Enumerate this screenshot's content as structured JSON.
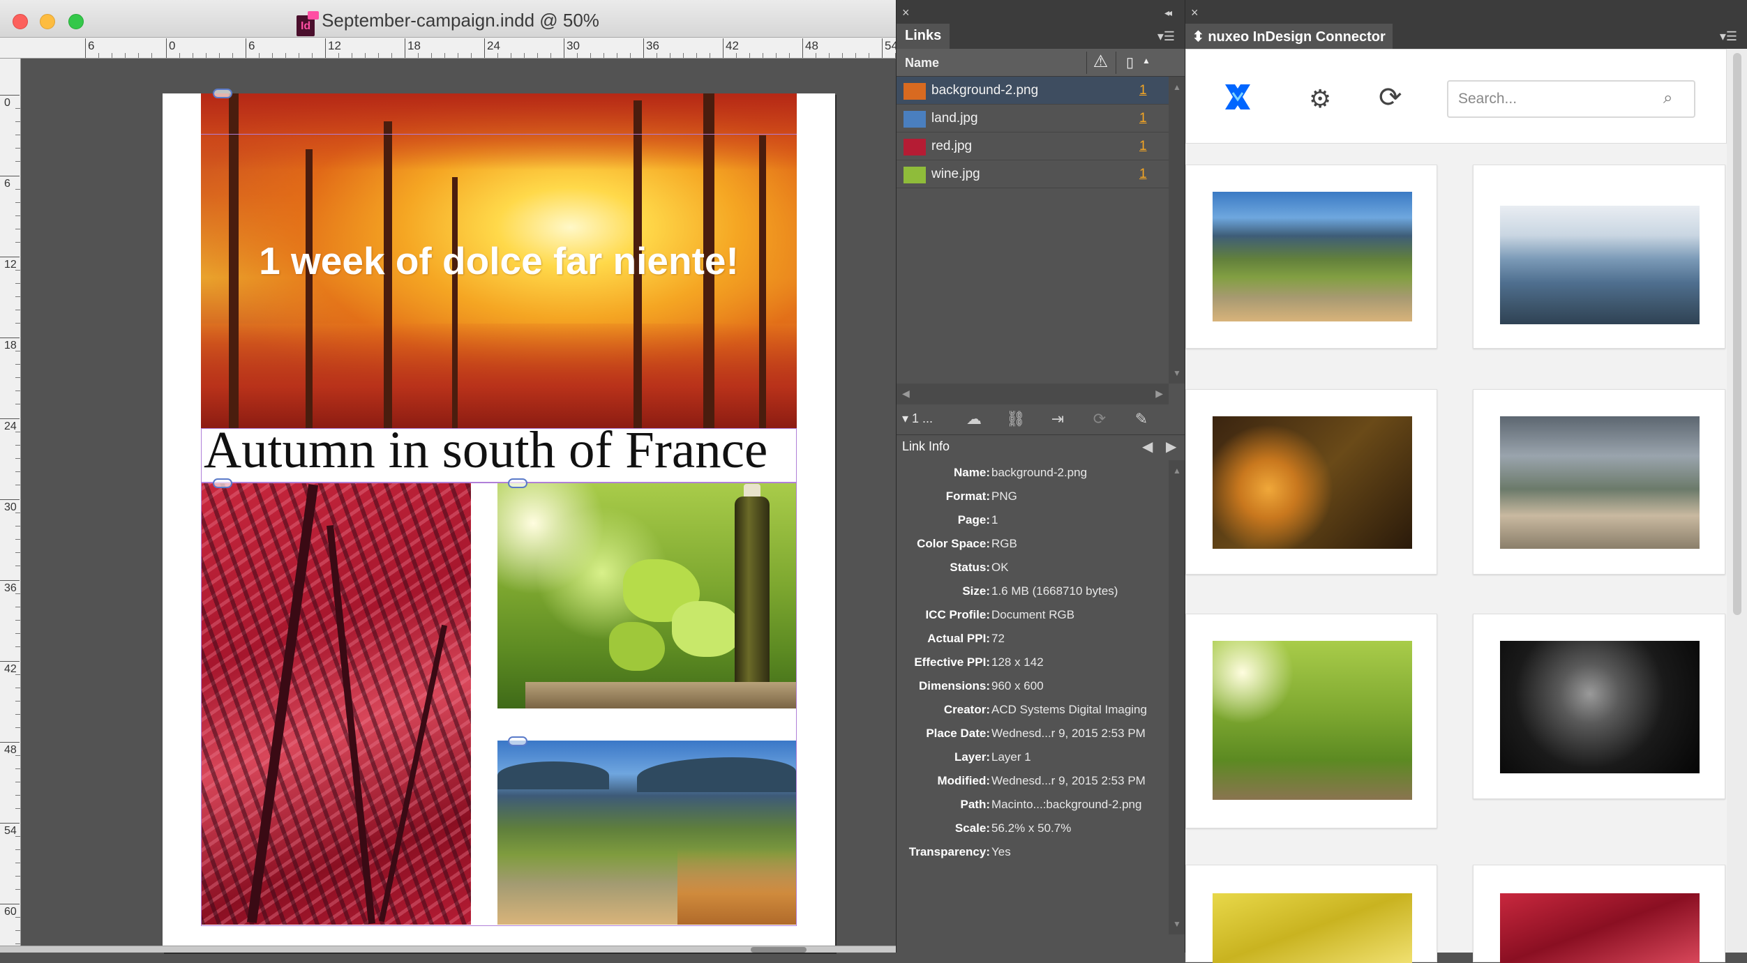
{
  "document_window": {
    "title": "September-campaign.indd @ 50%",
    "ruler_top_labels": [
      "6",
      "0",
      "6",
      "12",
      "18",
      "24",
      "30",
      "36",
      "42",
      "48",
      "54"
    ],
    "ruler_left_labels": [
      "0",
      "6",
      "12",
      "18",
      "24",
      "30",
      "36",
      "42",
      "48",
      "54",
      "60"
    ],
    "hero_text": "1 week of dolce far niente!",
    "heading": "Autumn in south of France"
  },
  "links_panel": {
    "tab_label": "Links",
    "column_name": "Name",
    "links": [
      {
        "name": "background-2.png",
        "page": "1",
        "selected": true,
        "thumb_color": "#d86a20"
      },
      {
        "name": "land.jpg",
        "page": "1",
        "selected": false,
        "thumb_color": "#4a7fbf"
      },
      {
        "name": "red.jpg",
        "page": "1",
        "selected": false,
        "thumb_color": "#b51c34"
      },
      {
        "name": "wine.jpg",
        "page": "1",
        "selected": false,
        "thumb_color": "#8fbc3a"
      }
    ],
    "selection_count": "1 ...",
    "link_info_title": "Link Info",
    "link_info": [
      {
        "key": "Name:",
        "value": "background-2.png"
      },
      {
        "key": "Format:",
        "value": "PNG"
      },
      {
        "key": "Page:",
        "value": "1"
      },
      {
        "key": "Color Space:",
        "value": "RGB"
      },
      {
        "key": "Status:",
        "value": "OK"
      },
      {
        "key": "Size:",
        "value": "1.6 MB (1668710 bytes)"
      },
      {
        "key": "ICC Profile:",
        "value": "Document RGB"
      },
      {
        "key": "Actual PPI:",
        "value": "72"
      },
      {
        "key": "Effective PPI:",
        "value": "128 x 142"
      },
      {
        "key": "Dimensions:",
        "value": "960 x 600"
      },
      {
        "key": "Creator:",
        "value": "ACD Systems Digital Imaging"
      },
      {
        "key": "Place Date:",
        "value": "Wednesd...r 9, 2015 2:53 PM"
      },
      {
        "key": "Layer:",
        "value": "Layer 1"
      },
      {
        "key": "Modified:",
        "value": "Wednesd...r 9, 2015 2:53 PM"
      },
      {
        "key": "Path:",
        "value": "Macinto...:background-2.png"
      },
      {
        "key": "Scale:",
        "value": "56.2% x 50.7%"
      },
      {
        "key": "Transparency:",
        "value": "Yes"
      }
    ]
  },
  "nuxeo_panel": {
    "tab_label": "nuxeo InDesign Connector",
    "search_placeholder": "Search...",
    "accent_color": "#0066ff",
    "assets": [
      "mountain-valley",
      "misty-mountains",
      "autumn-leaves",
      "cloudy-terrace",
      "wine-bottle",
      "black-white-portrait",
      "yellow-leaves",
      "red-foliage"
    ]
  }
}
